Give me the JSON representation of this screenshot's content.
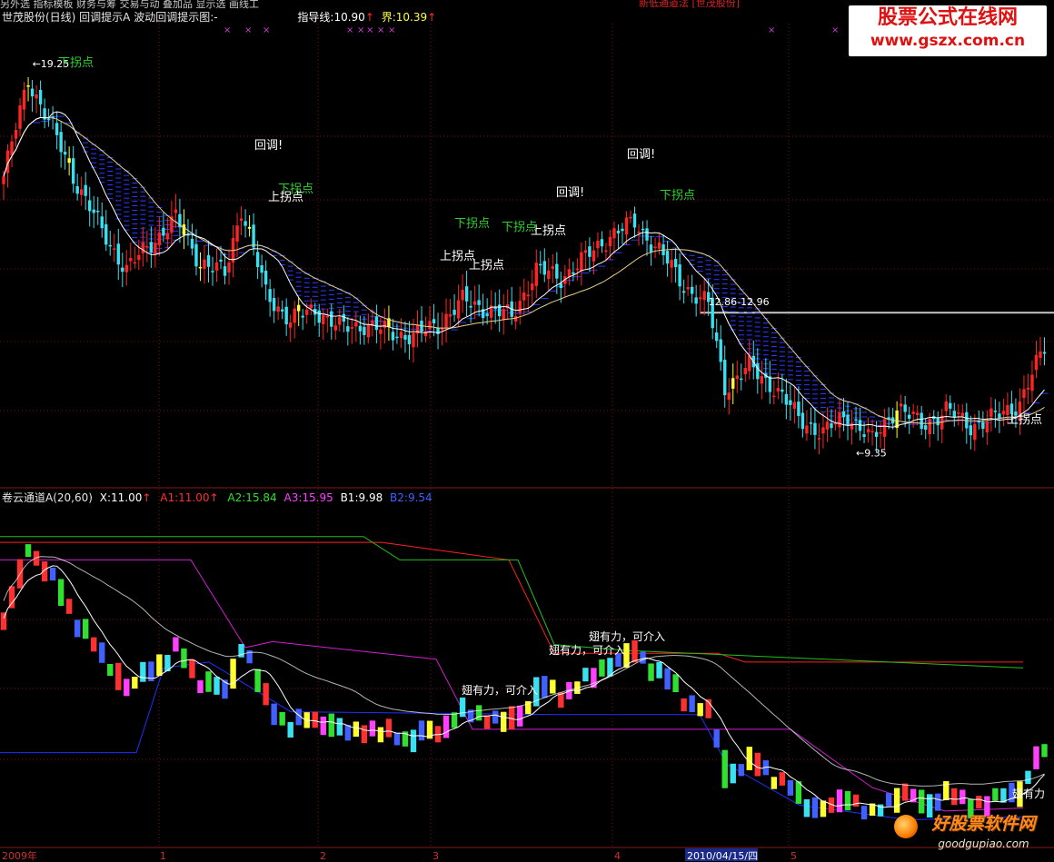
{
  "upper_header": {
    "title": "世茂股份(日线) 回调提示A 波动回调提示图:-",
    "guide_label": "指导线:10.90",
    "guide_arrow": "↑",
    "bound_label": "界:10.39",
    "bound_arrow": "↑"
  },
  "top_cut_text": "另外选  指标模板  财务与筹  交易与动  叠加品  显示选  画线工",
  "top_cut_right": "新低通道法 [世茂股份]",
  "lower_header": {
    "title": "卷云通道A(20,60)",
    "x": "X:11.00",
    "x_arrow": "↑",
    "a1": "A1:11.00",
    "a1_arrow": "↑",
    "a2": "A2:15.84",
    "a3": "A3:15.95",
    "b1": "B1:9.98",
    "b2": "B2:9.54"
  },
  "watermark_top": {
    "title": "股票公式在线网",
    "url": "www.gszx.com.cn"
  },
  "watermark_bottom": {
    "title": "好股票软件网",
    "url": "goodgupiao.com"
  },
  "colors": {
    "up": "#ff2424",
    "down": "#38e0f0",
    "warn": "#ffff30",
    "ma_long": "#e8d08a",
    "ma_short": "#ffffff",
    "channel_red": "#ff2020",
    "channel_green": "#20c020",
    "channel_magenta": "#d020d0",
    "channel_blue": "#2030ff",
    "grid": "#7a1010",
    "header_red": "#ff3030",
    "header_green": "#30e030",
    "header_magenta": "#ff40ff",
    "header_blue": "#4060ff"
  },
  "chart_data": [
    {
      "type": "candlestick",
      "panel": "upper",
      "stock": "世茂股份",
      "y_reference_line": 12.9,
      "extremes": [
        {
          "label": "19.25",
          "value": 19.25,
          "arrow": "←"
        },
        {
          "label": "9.35",
          "value": 9.35,
          "arrow": "←"
        }
      ],
      "range_label": "12.86-12.96",
      "annotations": [
        {
          "text": "下拐点",
          "color": "#30d030"
        },
        {
          "text": "回调!",
          "color": "#ffffff"
        },
        {
          "text": "下拐点",
          "color": "#30d030"
        },
        {
          "text": "上拐点",
          "color": "#ffffff"
        },
        {
          "text": "下拐点",
          "color": "#30d030"
        },
        {
          "text": "下拐点",
          "color": "#30d030"
        },
        {
          "text": "上拐点",
          "color": "#ffffff"
        },
        {
          "text": "上拐点",
          "color": "#ffffff"
        },
        {
          "text": "上拐点",
          "color": "#ffffff"
        },
        {
          "text": "回调!",
          "color": "#ffffff"
        },
        {
          "text": "回调!",
          "color": "#ffffff"
        },
        {
          "text": "下拐点",
          "color": "#30d030"
        },
        {
          "text": "上拐点",
          "color": "#ffffff"
        }
      ]
    },
    {
      "type": "candlestick",
      "panel": "lower",
      "indicator": "卷云通道A(20,60)",
      "annotations": [
        {
          "text": "翅有力，可介入"
        },
        {
          "text": "翅有力，可介入"
        },
        {
          "text": "翅有力，可介入"
        },
        {
          "text": "翅有力"
        }
      ]
    }
  ],
  "x_axis": {
    "labels": [
      "2009年",
      "1",
      "2",
      "3",
      "4",
      "2010/04/15/四",
      "5"
    ]
  }
}
